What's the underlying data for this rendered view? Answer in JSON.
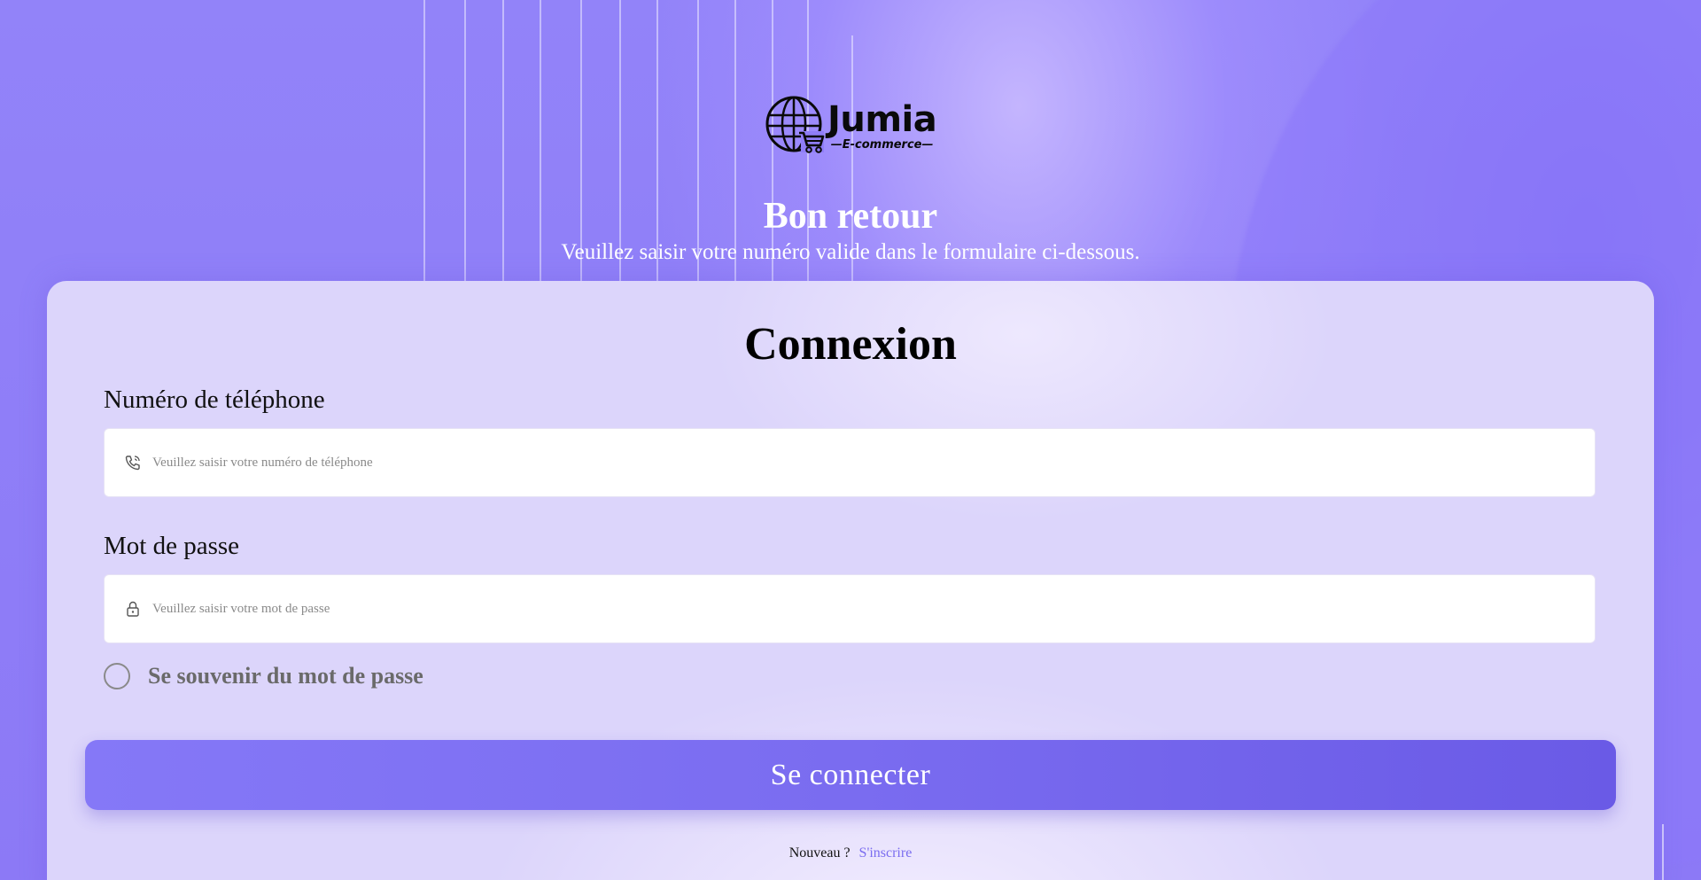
{
  "brand": {
    "name": "Jumia",
    "tagline": "—E-commerce—"
  },
  "welcome": {
    "title": "Bon retour",
    "subtitle": "Veuillez saisir votre numéro valide dans le formulaire ci-dessous."
  },
  "form": {
    "title": "Connexion",
    "phone": {
      "label": "Numéro de téléphone",
      "placeholder": "Veuillez saisir votre numéro de téléphone",
      "value": "",
      "icon": "phone-icon"
    },
    "password": {
      "label": "Mot de passe",
      "placeholder": "Veuillez saisir votre mot de passe",
      "value": "",
      "icon": "lock-icon"
    },
    "remember_label": "Se souvenir du mot de passe",
    "remember_checked": false,
    "submit_label": "Se connecter",
    "signup_prompt": "Nouveau ?",
    "signup_link": "S'inscrire"
  },
  "colors": {
    "background": "#8f7df7",
    "card": "#dcd5fb",
    "accent": "#7a6cf0",
    "text": "#111111"
  }
}
